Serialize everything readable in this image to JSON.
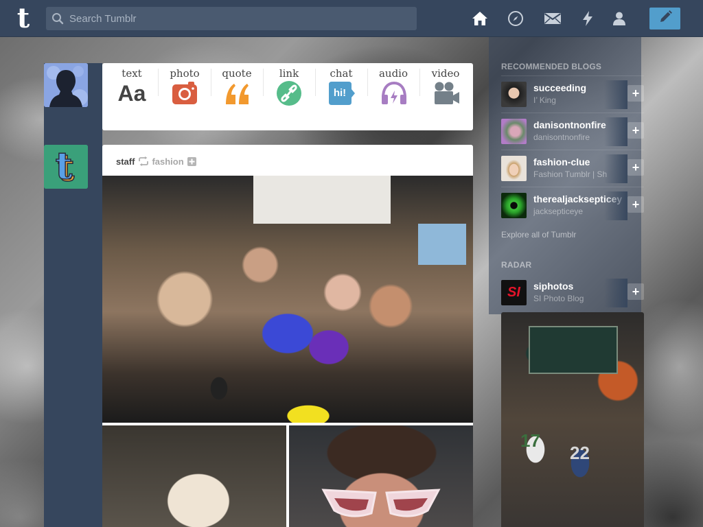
{
  "header": {
    "logo": "t",
    "search_placeholder": "Search Tumblr",
    "nav_icons": [
      "home-icon",
      "explore-compass-icon",
      "inbox-envelope-icon",
      "activity-lightning-icon",
      "account-person-icon"
    ],
    "compose_icon": "pencil-icon"
  },
  "composer": {
    "types": [
      {
        "label": "text",
        "glyph": "Aa",
        "color": "#444444"
      },
      {
        "label": "photo",
        "color": "#d95e40"
      },
      {
        "label": "quote",
        "color": "#f2992e"
      },
      {
        "label": "link",
        "color": "#56bc8a"
      },
      {
        "label": "chat",
        "glyph": "hi!",
        "color": "#529ecc"
      },
      {
        "label": "audio",
        "color": "#a77dc2"
      },
      {
        "label": "video",
        "color": "#748089"
      }
    ]
  },
  "post": {
    "author": "staff",
    "reblogged_from": "fashion",
    "staff_avatar_letter": "t"
  },
  "sidebar": {
    "recommended_title": "RECOMMENDED BLOGS",
    "blogs": [
      {
        "name": "succeeding",
        "subtitle": "I’ King"
      },
      {
        "name": "danisontnonfire",
        "subtitle": "danisontnonfire"
      },
      {
        "name": "fashion-clue",
        "subtitle": "Fashion Tumblr | Sh"
      },
      {
        "name": "therealjacksepticey",
        "subtitle": "jacksepticeye"
      }
    ],
    "follow_label": "+",
    "explore_link": "Explore all of Tumblr",
    "radar_title": "RADAR",
    "radar_blog": {
      "name": "siphotos",
      "subtitle": "SI Photo Blog",
      "badge": "SI"
    },
    "radar_jerseys": [
      "17",
      "22"
    ]
  },
  "colors": {
    "header_bg": "#36465d",
    "compose_bg": "#529ecc",
    "post_bg": "#ffffff"
  }
}
